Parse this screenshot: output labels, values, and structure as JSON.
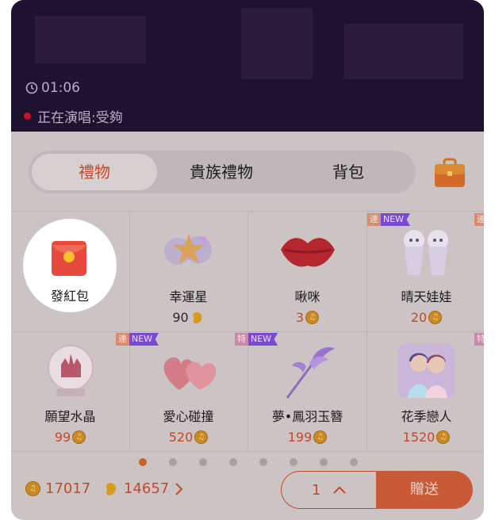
{
  "stream": {
    "timer": "01:06",
    "now_singing": "正在演唱:受夠"
  },
  "tabs": [
    "禮物",
    "貴族禮物",
    "背包"
  ],
  "active_tab": "禮物",
  "gifts": [
    {
      "name": "發紅包",
      "price": "",
      "currency": "",
      "tags": [],
      "icon": "red-packet-icon"
    },
    {
      "name": "幸運星",
      "price": "90",
      "currency": "bean",
      "tags": [],
      "icon": "lucky-star-icon"
    },
    {
      "name": "啾咪",
      "price": "3",
      "currency": "coin",
      "tags": [],
      "icon": "kiss-lips-icon"
    },
    {
      "name": "晴天娃娃",
      "price": "20",
      "currency": "coin",
      "tags": [
        "連",
        "NEW"
      ],
      "icon": "teru-teru-bozu-icon"
    },
    {
      "name": "願望水晶",
      "price": "99",
      "currency": "coin",
      "tags": [],
      "icon": "crystal-ball-icon"
    },
    {
      "name": "愛心碰撞",
      "price": "520",
      "currency": "coin",
      "tags": [
        "連",
        "NEW"
      ],
      "icon": "heart-collide-icon"
    },
    {
      "name": "夢•鳳羽玉簪",
      "price": "199",
      "currency": "coin",
      "tags": [
        "特",
        "NEW"
      ],
      "icon": "phoenix-hairpin-icon"
    },
    {
      "name": "花季戀人",
      "price": "1520",
      "currency": "coin",
      "tags": [],
      "icon": "anime-couple-icon"
    }
  ],
  "partial_tags": {
    "row1": "連",
    "row2": "特"
  },
  "pager": {
    "pages": 8,
    "active": 1
  },
  "footer": {
    "coins": "17017",
    "beans": "14657",
    "quantity": "1",
    "send_label": "贈送"
  },
  "colors": {
    "accent": "#c5492a",
    "panel": "#cbc3c4",
    "stream_bg": "#1f1230"
  }
}
